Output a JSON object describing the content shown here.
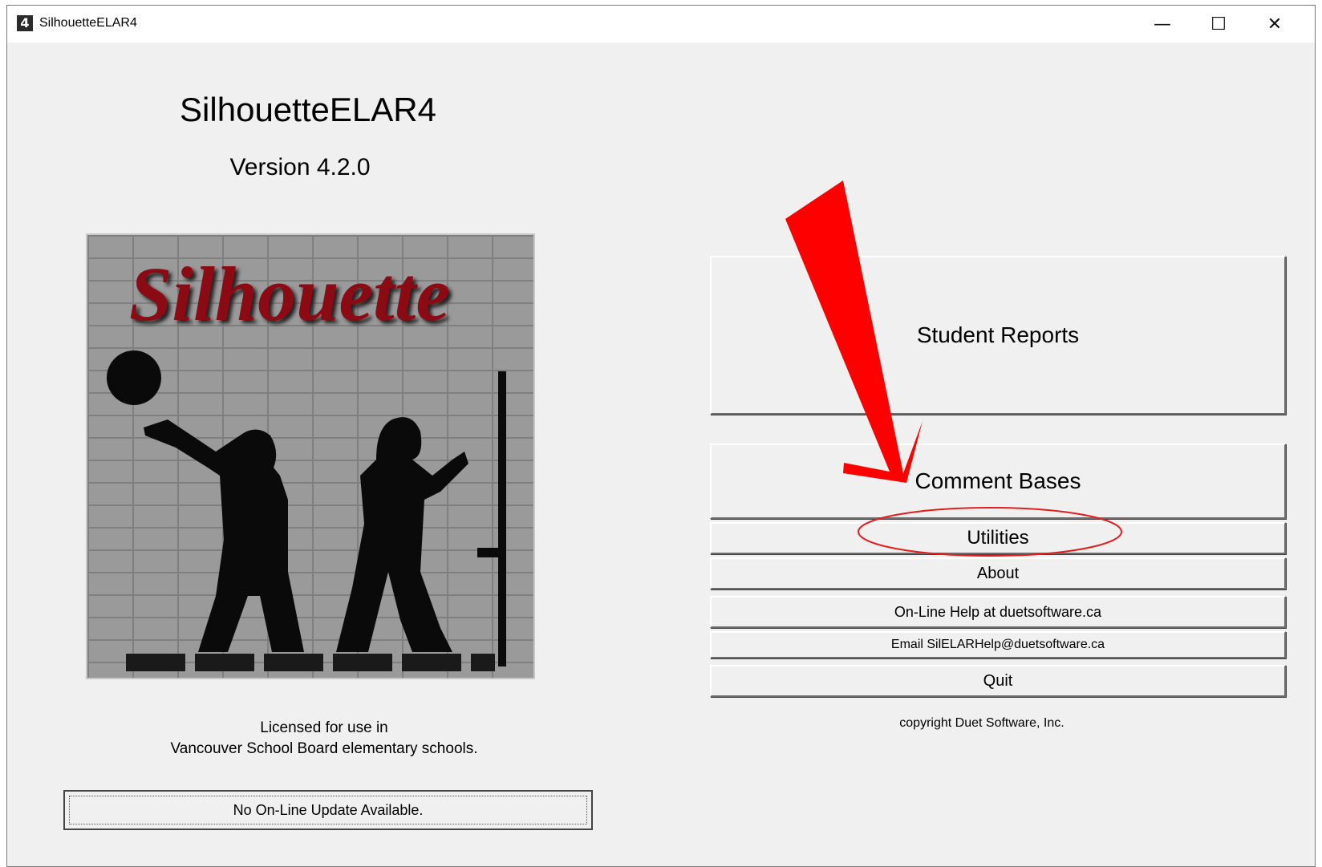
{
  "window": {
    "title": "SilhouetteELAR4",
    "icon_glyph": "4",
    "controls": {
      "minimize": "—",
      "maximize": "☐",
      "close": "✕"
    }
  },
  "main": {
    "app_title": "SilhouetteELAR4",
    "version": "Version 4.2.0",
    "logo_text": "Silhouette",
    "license_line1": "Licensed for use in",
    "license_line2": "Vancouver School Board elementary schools.",
    "update_button": "No On-Line Update Available."
  },
  "menu": {
    "student_reports": "Student Reports",
    "comment_bases": "Comment Bases",
    "utilities": "Utilities",
    "about": "About",
    "online_help": "On-Line Help at duetsoftware.ca",
    "email": "Email SilELARHelp@duetsoftware.ca",
    "quit": "Quit"
  },
  "copyright": "copyright Duet Software, Inc.",
  "annotation": {
    "arrow_color": "#ff0000",
    "highlight_color": "#e31c1c"
  }
}
